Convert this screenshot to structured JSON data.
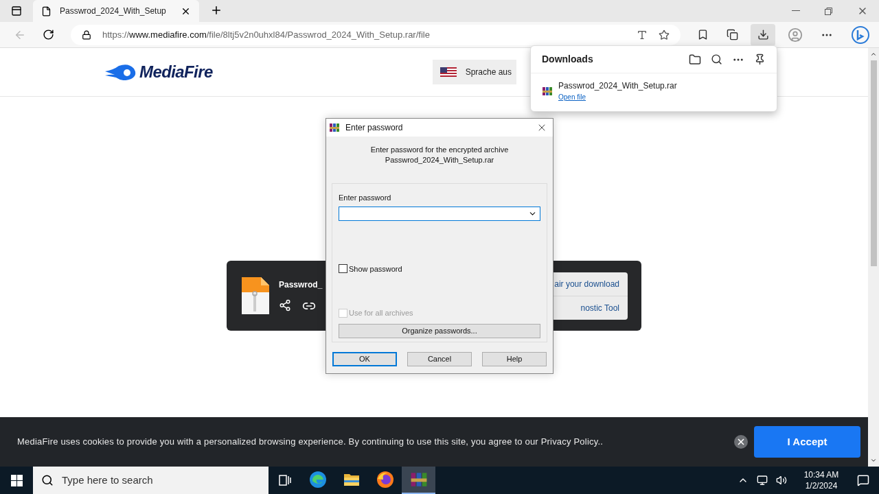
{
  "browser": {
    "tab_title": "Passwrod_2024_With_Setup",
    "url": {
      "scheme": "https://",
      "host": "www.mediafire.com",
      "path": "/file/8ltj5v2n0uhxl84/Passwrod_2024_With_Setup.rar/file"
    }
  },
  "page": {
    "logo": "MediaFire",
    "language": "Sprache aus",
    "file_card": {
      "name": "Passwrod_",
      "links": [
        "air your download",
        "nostic Tool"
      ]
    }
  },
  "downloads": {
    "title": "Downloads",
    "items": [
      {
        "name": "Passwrod_2024_With_Setup.rar",
        "action": "Open file"
      }
    ]
  },
  "dialog": {
    "title": "Enter password",
    "message": [
      "Enter password for the encrypted archive",
      "Passwrod_2024_With_Setup.rar"
    ],
    "field_label": "Enter password",
    "options": [
      {
        "label": "Show password",
        "checked": false,
        "disabled": false
      },
      {
        "label": "Use for all archives",
        "checked": false,
        "disabled": true
      }
    ],
    "organize": "Organize passwords...",
    "buttons": [
      {
        "label": "OK",
        "selected": true
      },
      {
        "label": "Cancel",
        "selected": false
      },
      {
        "label": "Help",
        "selected": false
      }
    ]
  },
  "cookie_banner": {
    "text": "MediaFire uses cookies to provide you with a personalized browsing experience. By continuing to use this site, you agree to our Privacy Policy..",
    "button": "I Accept"
  },
  "taskbar": {
    "search_placeholder": "Type here to search",
    "apps": [
      {
        "kind": "edge",
        "selected": false
      },
      {
        "kind": "folder",
        "selected": false
      },
      {
        "kind": "firefox",
        "selected": false
      },
      {
        "kind": "winrar",
        "selected": true
      }
    ],
    "time": "10:34 AM",
    "date": "1/2/2024"
  }
}
